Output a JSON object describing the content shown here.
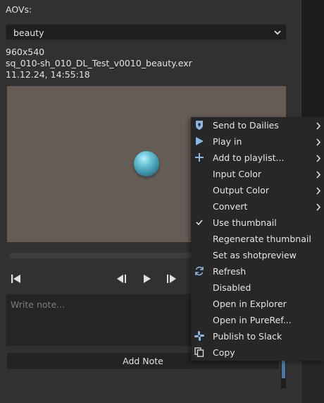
{
  "aovs": {
    "label": "AOVs:",
    "selected": "beauty"
  },
  "meta": {
    "resolution": "960x540",
    "filename": "sq_010-sh_010_DL_Test_v0010_beauty.exr",
    "datetime": "11.12.24,  14:55:18"
  },
  "note": {
    "placeholder": "Write note...",
    "add_label": "Add Note"
  },
  "player_controls": [
    "skip-to-start-icon",
    "step-back-icon",
    "play-icon",
    "step-forward-icon"
  ],
  "context_menu": {
    "items": [
      {
        "label": "Send to Dailies",
        "icon": "dailies-shield-icon",
        "submenu": true
      },
      {
        "label": "Play in",
        "icon": "play-triangle-icon",
        "submenu": true
      },
      {
        "label": "Add to playlist...",
        "icon": "plus-icon",
        "submenu": true
      },
      {
        "label": "Input Color",
        "icon": "",
        "submenu": true
      },
      {
        "label": "Output Color",
        "icon": "",
        "submenu": true
      },
      {
        "label": "Convert",
        "icon": "",
        "submenu": true
      },
      {
        "label": "Use thumbnail",
        "icon": "checkmark-icon",
        "submenu": false
      },
      {
        "label": "Regenerate thumbnail",
        "icon": "",
        "submenu": false
      },
      {
        "label": "Set as shotpreview",
        "icon": "",
        "submenu": false
      },
      {
        "label": "Refresh",
        "icon": "refresh-icon",
        "submenu": false
      },
      {
        "label": "Disabled",
        "icon": "",
        "submenu": false
      },
      {
        "label": "Open in Explorer",
        "icon": "",
        "submenu": false
      },
      {
        "label": "Open in PureRef...",
        "icon": "",
        "submenu": false
      },
      {
        "label": "Publish to Slack",
        "icon": "slack-icon",
        "submenu": false
      },
      {
        "label": "Copy",
        "icon": "copy-icon",
        "submenu": false
      }
    ]
  },
  "colors": {
    "accent": "#4a9fd8",
    "panel": "#313131",
    "menu": "#272727",
    "viewport": "#645c55"
  }
}
